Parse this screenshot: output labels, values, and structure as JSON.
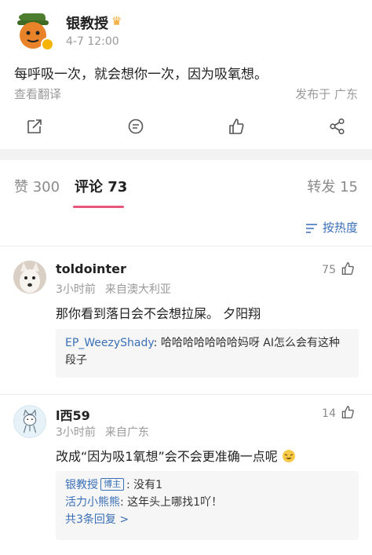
{
  "post": {
    "username": "银教授",
    "crown_glyph": "♛",
    "time": "4-7 12:00",
    "text": "每呼吸一次，就会想你一次，因为吸氧想。",
    "translate": "查看翻译",
    "location": "发布于 广东"
  },
  "tabs": {
    "likes": "赞 300",
    "comments": "评论 73",
    "reposts": "转发 15"
  },
  "sort_label": "按热度",
  "comments": [
    {
      "name": "toldointer",
      "time": "3小时前",
      "from": "来自澳大利亚",
      "likes": "75",
      "text": "那你看到落日会不会想拉屎。 夕阳翔",
      "reply": {
        "user": "EP_WeezyShady",
        "text": ": 哈哈哈哈哈哈哈妈呀 AI怎么会有这种段子"
      }
    },
    {
      "name": "l西59",
      "time": "3小时前",
      "from": "来自广东",
      "likes": "14",
      "text": "改成“因为吸1氧想”会不会更准确一点呢",
      "replies": [
        {
          "user": "银教授",
          "tag": "博主",
          "text": ": 没有1"
        },
        {
          "user": "活力小熊熊",
          "text": ": 这年头上哪找1吖！"
        }
      ],
      "more": "共3条回复 >"
    }
  ],
  "colors": {
    "accent": "#e8567a",
    "link": "#3a6fb7",
    "muted": "#9a9a9a"
  }
}
